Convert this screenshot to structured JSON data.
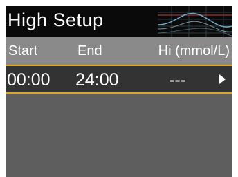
{
  "title": "High Setup",
  "columns": {
    "start": "Start",
    "end": "End",
    "hi": "Hi (mmol/L)"
  },
  "rows": [
    {
      "start": "00:00",
      "end": "24:00",
      "hi": "---"
    }
  ],
  "colors": {
    "title_bar": "#0a0a0a",
    "header_row": "#8a8a8a",
    "selected_row": "#333333",
    "highlight_border": "#d9a62a",
    "background": "#5e5e5e",
    "text": "#ffffff"
  },
  "icons": {
    "row_arrow": "right-arrow-icon",
    "header_graphic": "glucose-graph-icon"
  }
}
